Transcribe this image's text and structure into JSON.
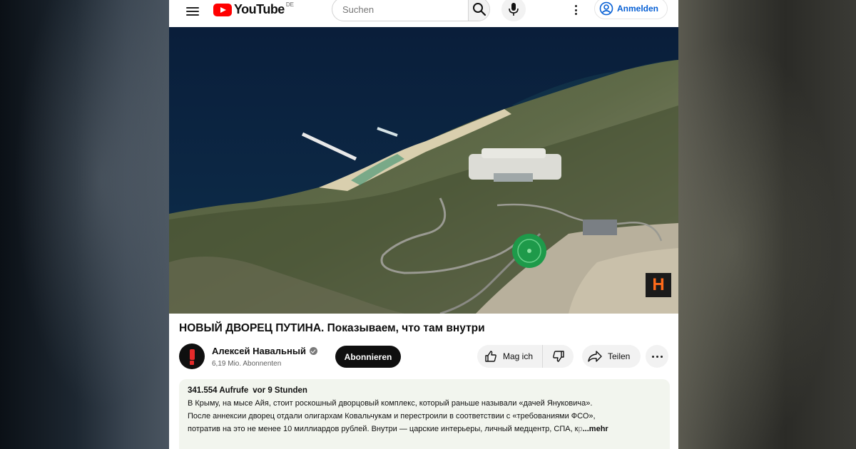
{
  "header": {
    "logo_text": "YouTube",
    "country_code": "DE",
    "search_placeholder": "Suchen",
    "signin_label": "Anmelden"
  },
  "video": {
    "watermark_letter": "H",
    "title": "НОВЫЙ ДВОРЕЦ ПУТИНА. Показываем, что там внутри"
  },
  "channel": {
    "name": "Алексей Навальный",
    "subscribers": "6,19 Mio. Abonnenten",
    "subscribe_label": "Abonnieren"
  },
  "actions": {
    "like_label": "Mag ich",
    "share_label": "Teilen"
  },
  "description": {
    "views": "341.554 Aufrufe",
    "age": "vor 9 Stunden",
    "line1": "В Крыму, на мысе Айя, стоит роскошный дворцовый комплекс, который раньше называли «дачей Януковича».",
    "line2": "После аннексии дворец отдали олигархам Ковальчукам и перестроили в соответствии с «требованиями ФСО»,",
    "line3": "потратив на это не менее 10 миллиардов рублей. Внутри — царские интерьеры, личный медцентр, СПА, к",
    "line3_fade": "р",
    "more_label": "...mehr"
  },
  "colors": {
    "brand_red": "#ff0000",
    "link_blue": "#065fd4",
    "watermark_orange": "#ff6a1a"
  }
}
